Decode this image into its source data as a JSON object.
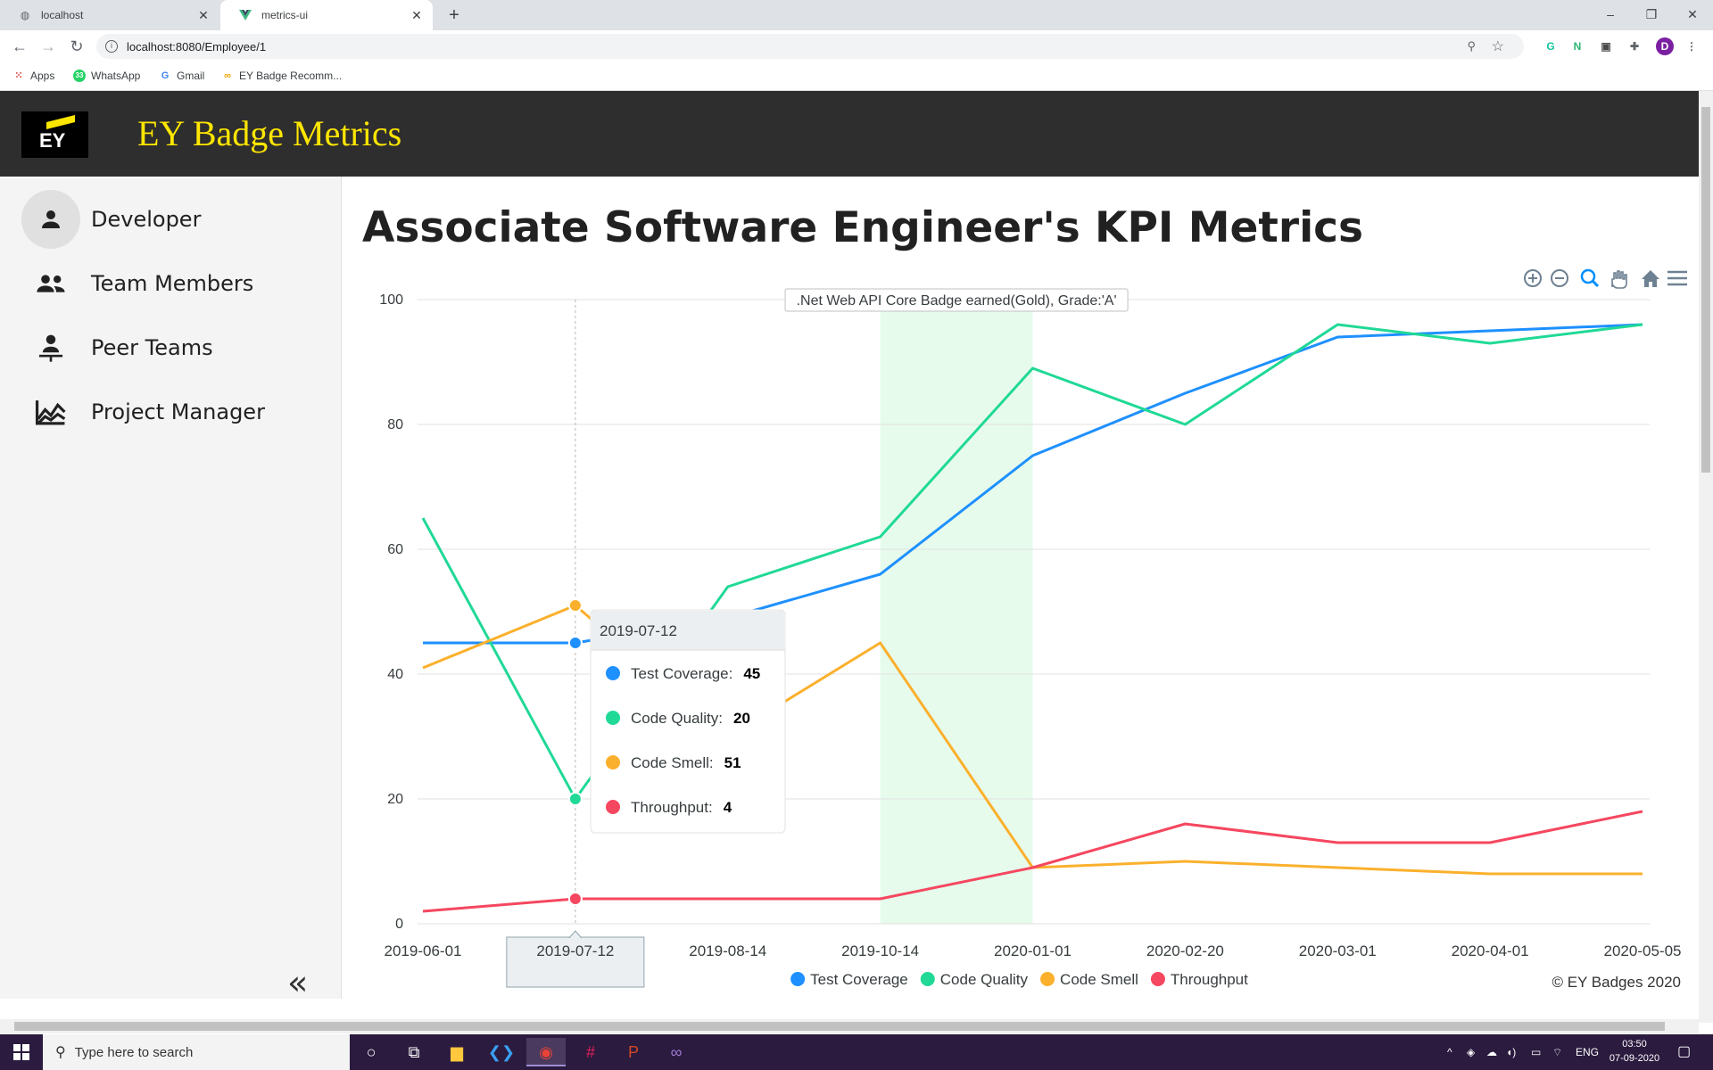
{
  "browser": {
    "tabs": [
      {
        "title": "localhost",
        "active": false
      },
      {
        "title": "metrics-ui",
        "active": true
      }
    ],
    "new_tab": "+",
    "url": "localhost:8080/Employee/1",
    "bookmarks": [
      "Apps",
      "WhatsApp",
      "Gmail",
      "EY Badge Recomm..."
    ],
    "profile_initial": "D",
    "window_controls": {
      "minimize": "–",
      "restore": "❐",
      "close": "✕"
    }
  },
  "app": {
    "logo_text": "EY",
    "title": "EY Badge Metrics"
  },
  "sidebar": {
    "items": [
      {
        "label": "Developer",
        "icon": "person-icon",
        "selected": true
      },
      {
        "label": "Team Members",
        "icon": "people-icon",
        "selected": false
      },
      {
        "label": "Peer Teams",
        "icon": "peer-teams-icon",
        "selected": false
      },
      {
        "label": "Project Manager",
        "icon": "trend-chart-icon",
        "selected": false
      }
    ],
    "collapse_label": "«"
  },
  "main": {
    "page_title": "Associate Software Engineer's KPI Metrics",
    "footer": "© EY Badges 2020"
  },
  "chart_data": {
    "type": "line",
    "categories": [
      "2019-06-01",
      "2019-07-12",
      "2019-08-14",
      "2019-10-14",
      "2020-01-01",
      "2020-02-20",
      "2020-03-01",
      "2020-04-01",
      "2020-05-05"
    ],
    "ylim": [
      0,
      100
    ],
    "yticks": [
      0,
      20,
      40,
      60,
      80,
      100
    ],
    "grid": true,
    "legend_position": "bottom-center",
    "series": [
      {
        "name": "Test Coverage",
        "color": "#1e90ff",
        "values": [
          45,
          45,
          49,
          56,
          75,
          85,
          94,
          95,
          96
        ]
      },
      {
        "name": "Code Quality",
        "color": "#20d996",
        "values": [
          65,
          20,
          54,
          62,
          89,
          80,
          96,
          93,
          96
        ]
      },
      {
        "name": "Code Smell",
        "color": "#fbb02d",
        "values": [
          41,
          51,
          30,
          45,
          9,
          10,
          9,
          8,
          8
        ]
      },
      {
        "name": "Throughput",
        "color": "#f5475f",
        "values": [
          2,
          4,
          4,
          4,
          9,
          16,
          13,
          13,
          18
        ]
      }
    ],
    "annotation": {
      "label": ".Net Web API Core Badge earned(Gold), Grade:'A'",
      "x_from": "2019-10-14",
      "x_to": "2020-01-01",
      "fill": "#e6fbec"
    },
    "tooltip": {
      "category": "2019-07-12",
      "rows": [
        {
          "name": "Test Coverage",
          "value": "45",
          "color": "#1e90ff"
        },
        {
          "name": "Code Quality",
          "value": "20",
          "color": "#20d996"
        },
        {
          "name": "Code Smell",
          "value": "51",
          "color": "#fbb02d"
        },
        {
          "name": "Throughput",
          "value": "4",
          "color": "#f5475f"
        }
      ]
    },
    "toolbar_icons": [
      "zoom-in-icon",
      "zoom-out-icon",
      "selection-zoom-icon",
      "pan-icon",
      "reset-home-icon",
      "menu-icon"
    ]
  },
  "taskbar": {
    "search_placeholder": "Type here to search",
    "language": "ENG",
    "time": "03:50",
    "date": "07-09-2020"
  }
}
